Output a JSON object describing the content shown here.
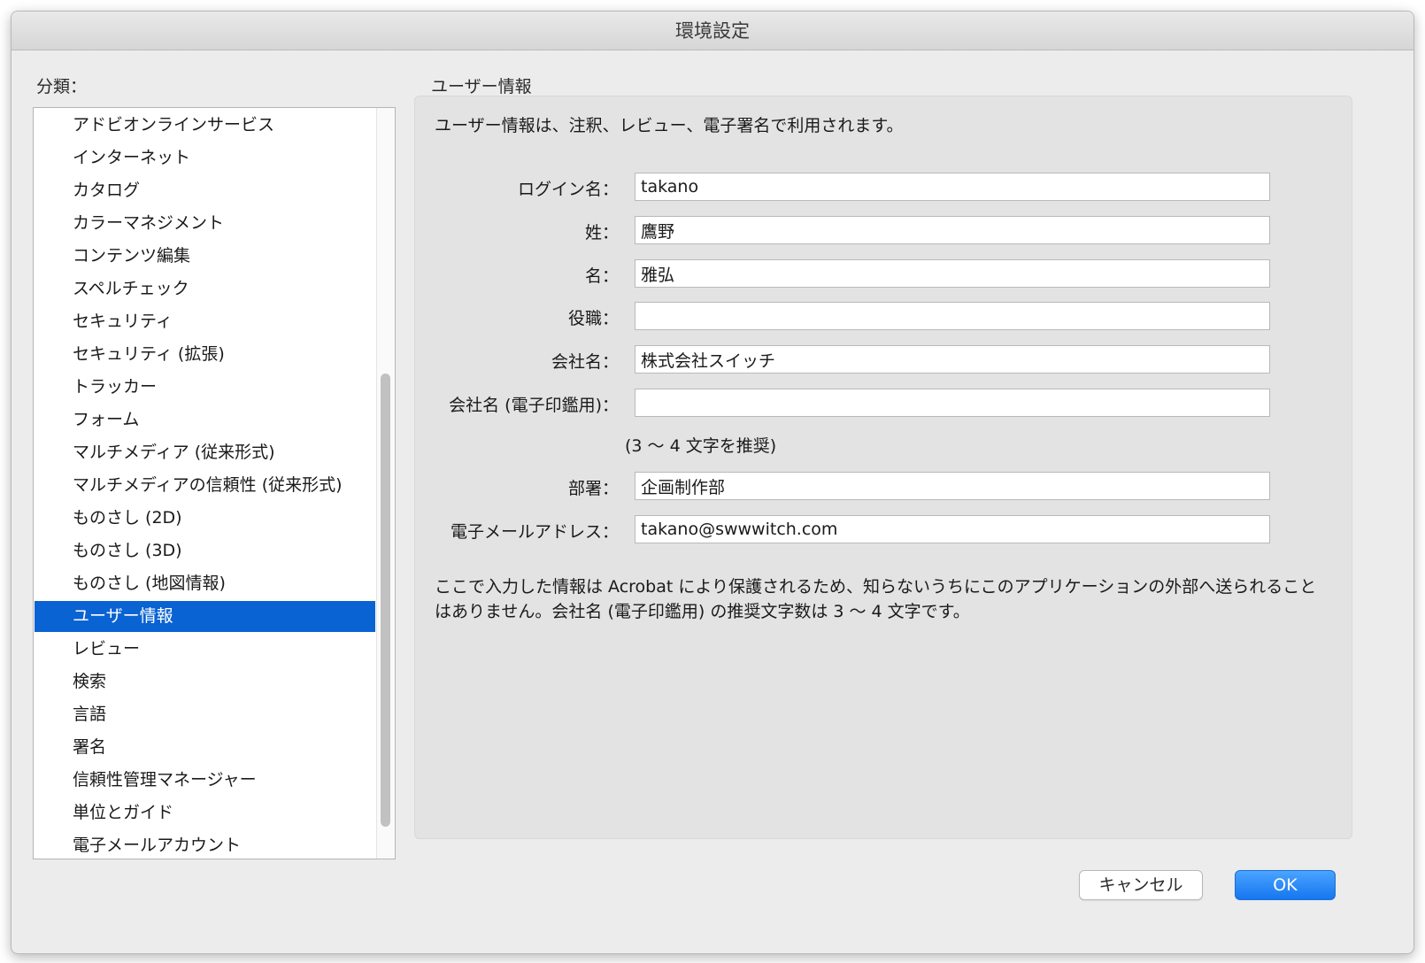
{
  "window": {
    "title": "環境設定"
  },
  "sidebar": {
    "label": "分類：",
    "selected_index": 15,
    "items": [
      {
        "label": "アドビオンラインサービス"
      },
      {
        "label": "インターネット"
      },
      {
        "label": "カタログ"
      },
      {
        "label": "カラーマネジメント"
      },
      {
        "label": "コンテンツ編集"
      },
      {
        "label": "スペルチェック"
      },
      {
        "label": "セキュリティ"
      },
      {
        "label": "セキュリティ (拡張)"
      },
      {
        "label": "トラッカー"
      },
      {
        "label": "フォーム"
      },
      {
        "label": "マルチメディア (従来形式)"
      },
      {
        "label": "マルチメディアの信頼性 (従来形式)"
      },
      {
        "label": "ものさし (2D)"
      },
      {
        "label": "ものさし (3D)"
      },
      {
        "label": "ものさし (地図情報)"
      },
      {
        "label": "ユーザー情報"
      },
      {
        "label": "レビュー"
      },
      {
        "label": "検索"
      },
      {
        "label": "言語"
      },
      {
        "label": "署名"
      },
      {
        "label": "信頼性管理マネージャー"
      },
      {
        "label": "単位とガイド"
      },
      {
        "label": "電子メールアカウント"
      }
    ]
  },
  "main": {
    "section_title": "ユーザー情報",
    "description": "ユーザー情報は、注釈、レビュー、電子署名で利用されます。",
    "fields": {
      "login": {
        "label": "ログイン名：",
        "value": "takano"
      },
      "last_name": {
        "label": "姓：",
        "value": "鷹野"
      },
      "first_name": {
        "label": "名：",
        "value": "雅弘"
      },
      "title": {
        "label": "役職：",
        "value": ""
      },
      "company": {
        "label": "会社名：",
        "value": "株式会社スイッチ"
      },
      "company_stamp": {
        "label": "会社名 (電子印鑑用)：",
        "value": ""
      },
      "department": {
        "label": "部署：",
        "value": "企画制作部"
      },
      "email": {
        "label": "電子メールアドレス：",
        "value": "takano@swwwitch.com"
      }
    },
    "stamp_hint": "(3 〜 4 文字を推奨)",
    "footnote": "ここで入力した情報は Acrobat により保護されるため、知らないうちにこのアプリケーションの外部へ送られることはありません。会社名 (電子印鑑用) の推奨文字数は 3 〜 4 文字です。"
  },
  "buttons": {
    "cancel": "キャンセル",
    "ok": "OK"
  }
}
